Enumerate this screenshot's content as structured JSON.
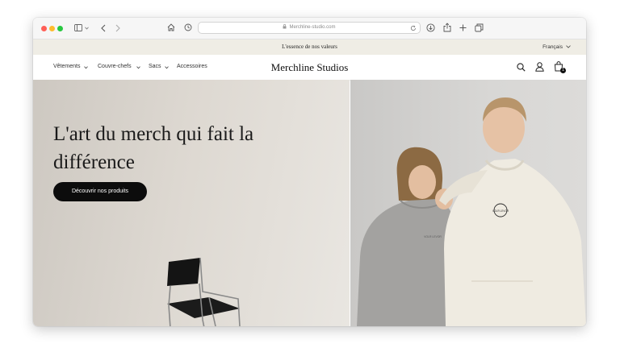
{
  "browser": {
    "url": "Merchline-studio.com"
  },
  "announcement": {
    "text": "L'essence de nos valeurs",
    "language": "Français"
  },
  "nav": {
    "menu": [
      {
        "label": "Vêtements"
      },
      {
        "label": "Couvre-chefs"
      },
      {
        "label": "Sacs"
      },
      {
        "label": "Accessoires"
      }
    ],
    "brand": "Merchline Studios",
    "cart_count": "1"
  },
  "hero": {
    "headline": "L'art du merch qui fait la différence",
    "cta_label": "Découvrir nos produits",
    "hoodie_print_left": "VOLR LEVOR",
    "hoodie_print_right": "VOLR LEVOR"
  },
  "colors": {
    "announce_bg": "#efede5",
    "cta_bg": "#0c0c0c",
    "traffic_red": "#ff5f57",
    "traffic_yellow": "#febc2e",
    "traffic_green": "#28c840"
  },
  "icons": [
    "sidebar-icon",
    "back-icon",
    "forward-icon",
    "home-icon",
    "history-icon",
    "lock-icon",
    "reload-icon",
    "download-icon",
    "share-icon",
    "new-tab-icon",
    "tabs-overview-icon",
    "search-icon",
    "account-icon",
    "bag-icon"
  ]
}
